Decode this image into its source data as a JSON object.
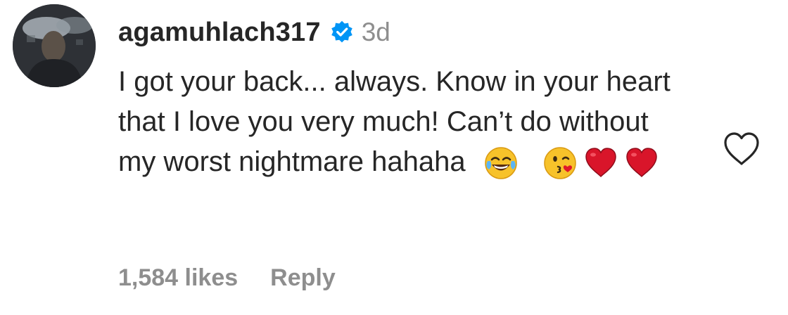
{
  "comment": {
    "username": "agamuhlach317",
    "time": "3d",
    "text": "I got your back... always. Know in your heart that I love you very much! Can’t do without my worst nightmare hahaha",
    "emojis": [
      "tears-of-joy-emoji",
      "face-blowing-kiss-emoji",
      "red-heart-emoji",
      "red-heart-emoji"
    ],
    "likes": "1,584 likes",
    "reply_label": "Reply"
  },
  "colors": {
    "text": "#262626",
    "muted": "#8e8e8e",
    "verified": "#0095f6"
  },
  "icons": {
    "verified": "verified-badge-icon",
    "like": "heart-outline-icon"
  }
}
